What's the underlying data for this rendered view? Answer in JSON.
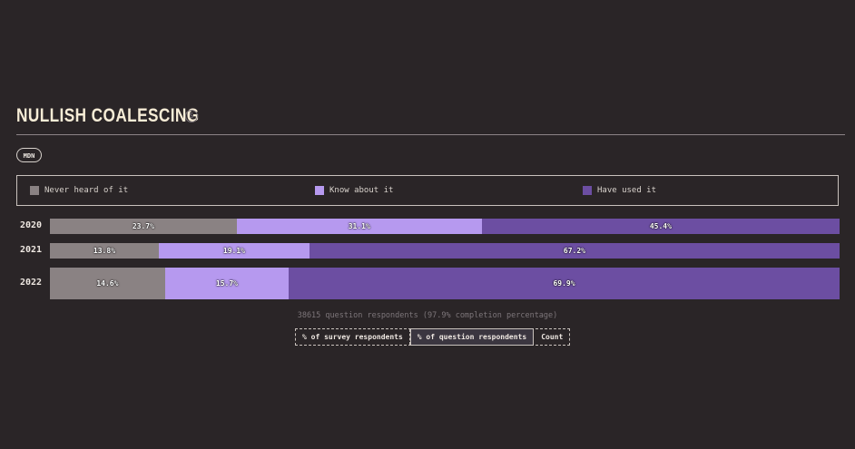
{
  "header": {
    "title": "NULLISH COALESCING",
    "info_icon": "dollar-circle-icon"
  },
  "source_button": {
    "label": "MDN"
  },
  "footer": {
    "respondents_text": "38615 question respondents (97.9% completion percentage)",
    "units": [
      {
        "label": "% of survey respondents",
        "active": false
      },
      {
        "label": "% of question respondents",
        "active": true
      },
      {
        "label": "Count",
        "active": false
      }
    ]
  },
  "colors": {
    "background": "#2a2527",
    "never_heard": "#8a8283",
    "know_about": "#b699ef",
    "have_used": "#6c4ea2"
  },
  "chart_data": {
    "type": "bar",
    "orientation": "horizontal-stacked",
    "title": "NULLISH COALESCING",
    "categories": [
      "2020",
      "2021",
      "2022"
    ],
    "legend_placement": "top",
    "xlim": [
      0,
      100
    ],
    "series": [
      {
        "name": "Never heard of it",
        "color": "#8a8283",
        "values": [
          23.7,
          13.8,
          14.6
        ],
        "labels": [
          "23.7%",
          "13.8%",
          "14.6%"
        ]
      },
      {
        "name": "Know about it",
        "color": "#b699ef",
        "values": [
          31.1,
          19.1,
          15.7
        ],
        "labels": [
          "31.1%",
          "19.1%",
          "15.7%"
        ]
      },
      {
        "name": "Have used it",
        "color": "#6c4ea2",
        "values": [
          45.4,
          67.2,
          69.9
        ],
        "labels": [
          "45.4%",
          "67.2%",
          "69.9%"
        ]
      }
    ]
  }
}
